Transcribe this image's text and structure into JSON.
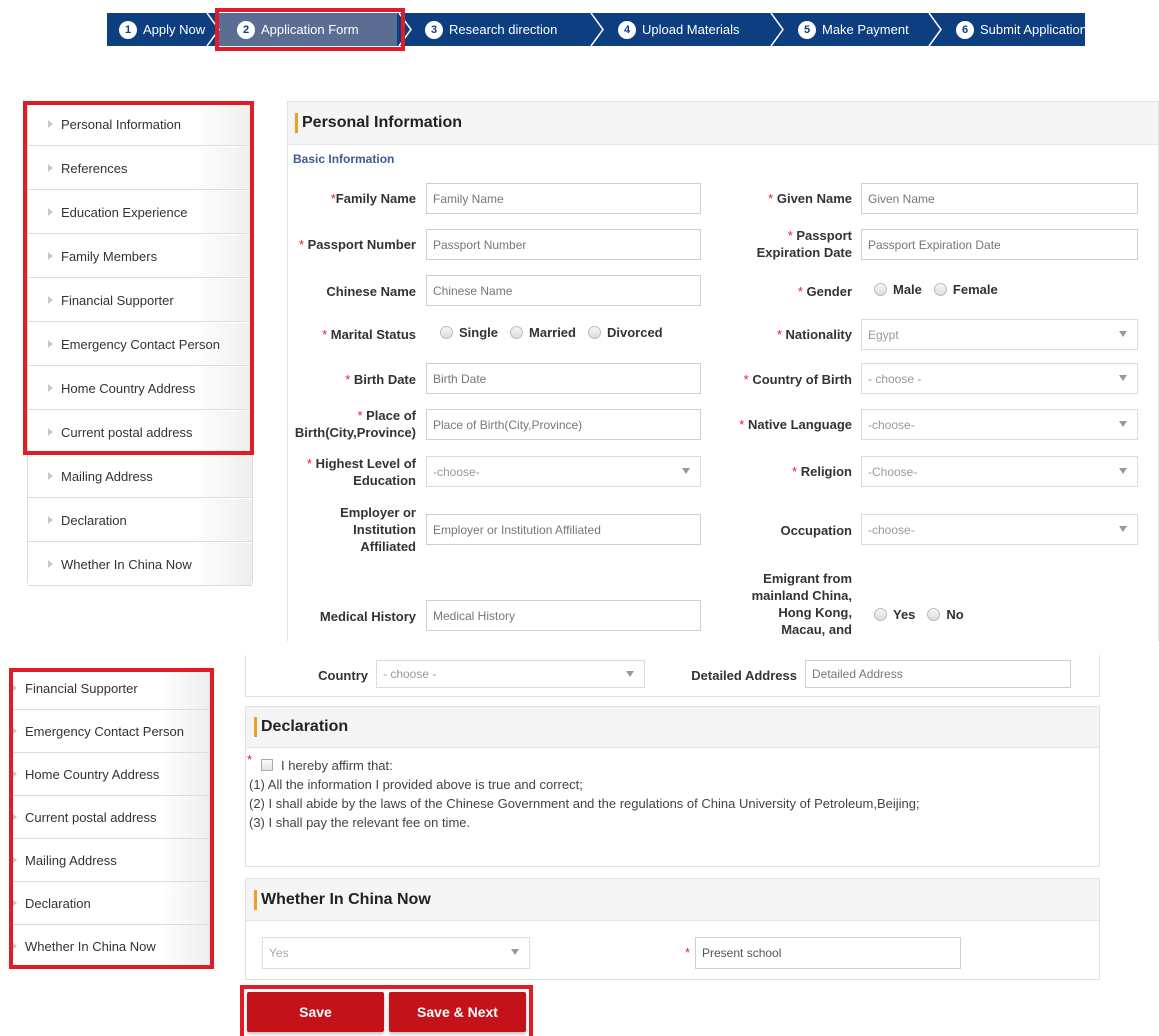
{
  "steps": [
    {
      "num": "1",
      "label": "Apply Now"
    },
    {
      "num": "2",
      "label": "Application Form"
    },
    {
      "num": "3",
      "label": "Research direction"
    },
    {
      "num": "4",
      "label": "Upload Materials"
    },
    {
      "num": "5",
      "label": "Make Payment"
    },
    {
      "num": "6",
      "label": "Submit Application"
    }
  ],
  "sidebar_top": [
    "Personal Information",
    "References",
    "Education Experience",
    "Family Members",
    "Financial Supporter",
    "Emergency Contact Person",
    "Home Country Address",
    "Current postal address",
    "Mailing Address",
    "Declaration",
    "Whether In China Now"
  ],
  "sidebar_bottom": [
    "Financial Supporter",
    "Emergency Contact Person",
    "Home Country Address",
    "Current postal address",
    "Mailing Address",
    "Declaration",
    "Whether In China Now"
  ],
  "personal": {
    "title": "Personal Information",
    "subtitle": "Basic Information",
    "family_name": {
      "label": "Family Name",
      "placeholder": "Family Name"
    },
    "given_name": {
      "label": "Given Name",
      "placeholder": "Given Name"
    },
    "passport_number": {
      "label": "Passport Number",
      "placeholder": "Passport Number"
    },
    "passport_expiry": {
      "label_1": "Passport",
      "label_2": "Expiration Date",
      "placeholder": "Passport Expiration Date"
    },
    "chinese_name": {
      "label": "Chinese Name",
      "placeholder": "Chinese Name"
    },
    "gender": {
      "label": "Gender",
      "options": [
        "Male",
        "Female"
      ]
    },
    "marital": {
      "label": "Marital Status",
      "options": [
        "Single",
        "Married",
        "Divorced"
      ]
    },
    "nationality": {
      "label": "Nationality",
      "value": "Egypt"
    },
    "birth_date": {
      "label": "Birth Date",
      "placeholder": "Birth Date"
    },
    "country_of_birth": {
      "label": "Country of Birth",
      "value": "- choose -"
    },
    "place_of_birth": {
      "label_1": "Place of",
      "label_2": "Birth(City,Province)",
      "placeholder": "Place of Birth(City,Province)"
    },
    "native_language": {
      "label": "Native Language",
      "value": "-choose-"
    },
    "education": {
      "label_1": "Highest Level of",
      "label_2": "Education",
      "value": "-choose-"
    },
    "religion": {
      "label": "Religion",
      "value": "-Choose-"
    },
    "employer": {
      "label_1": "Employer or",
      "label_2": "Institution",
      "label_3": "Affiliated",
      "placeholder": "Employer or Institution Affiliated"
    },
    "occupation": {
      "label": "Occupation",
      "value": "-choose-"
    },
    "emigrant": {
      "label_1": "Emigrant from",
      "label_2": "mainland China,",
      "label_3": "Hong Kong,",
      "label_4": "Macau, and",
      "options": [
        "Yes",
        "No"
      ]
    },
    "medical_history": {
      "label": "Medical History",
      "placeholder": "Medical History"
    }
  },
  "address": {
    "country_label": "Country",
    "country_value": "- choose -",
    "detailed_label": "Detailed Address",
    "detailed_placeholder": "Detailed Address"
  },
  "declaration": {
    "title": "Declaration",
    "affirm": "I hereby affirm that:",
    "line1": "(1) All the information I provided above is true and correct;",
    "line2": "(2) I shall abide by the laws of the Chinese Government and the regulations of China University of Petroleum,Beijing;",
    "line3": "(3) I shall pay the relevant fee on time."
  },
  "china": {
    "title": "Whether In China Now",
    "value": "Yes",
    "school_placeholder": "Present school"
  },
  "buttons": {
    "save": "Save",
    "save_next": "Save & Next"
  },
  "colors": {
    "stepbar": "#0d3f80",
    "active_step": "#5c6d94",
    "highlight": "#e11c26",
    "button": "#c4121a",
    "accent": "#f0a020"
  }
}
